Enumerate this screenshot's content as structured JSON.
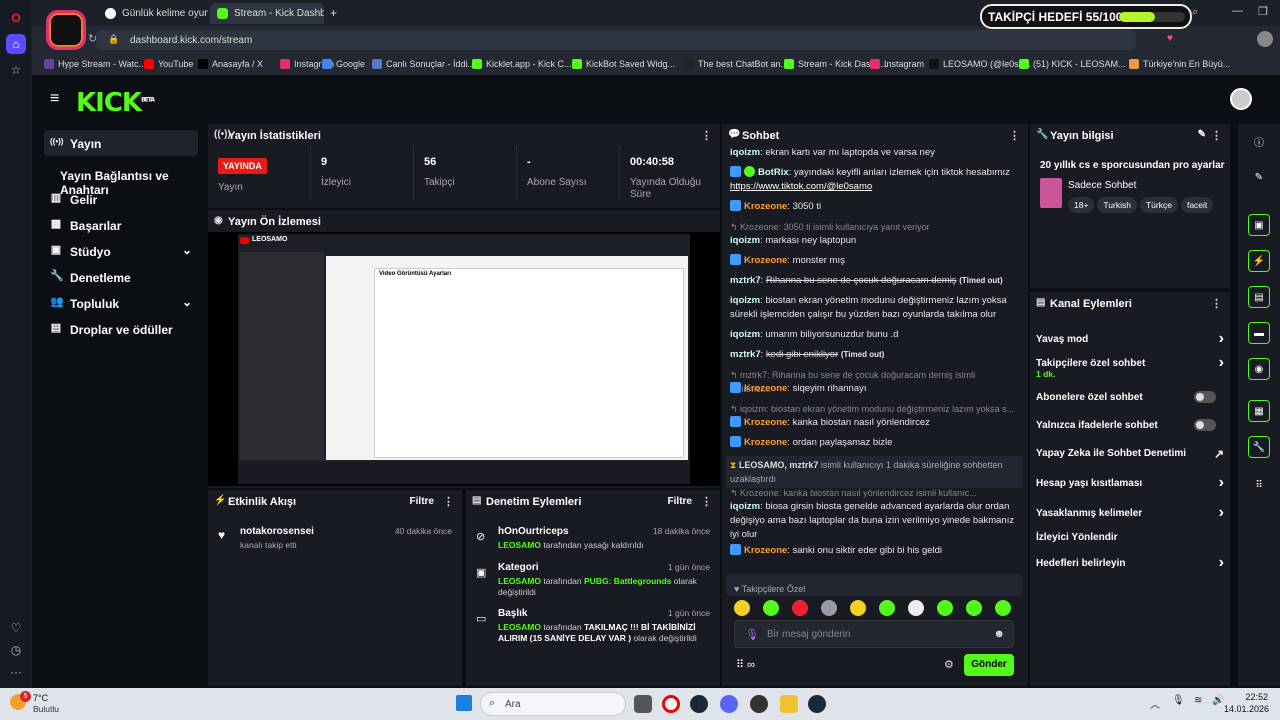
{
  "browser": {
    "tabs": [
      {
        "label": "Günlük kelime oyunu - pa"
      },
      {
        "label": "Stream - Kick Dashboard"
      }
    ],
    "new_tab": "+",
    "url": "dashboard.kick.com/stream",
    "bookmarks": [
      "Hype Stream - Watc...",
      "YouTube",
      "Anasayfa / X",
      "Instagram",
      "Google",
      "Canlı Sonuçlar - İddi...",
      "Kicklet.app - Kick C...",
      "KickBot Saved Widg...",
      "The best ChatBot an...",
      "Stream - Kick Dashb...",
      "Instagram",
      "LEOSAMO (@le0sa...",
      "(51) KICK - LEOSAM...",
      "Türkiye'nin En Büyü..."
    ]
  },
  "goal": {
    "text": "TAKİPÇİ HEDEFİ 55/100",
    "progress": 0.55
  },
  "kick": {
    "logo": "KICK",
    "logo_sup": "BETA",
    "nav": [
      {
        "label": "Yayın",
        "icon": "broadcast-icon"
      },
      {
        "label": "Yayın Bağlantısı ve Anahtarı"
      },
      {
        "label": "Gelir",
        "icon": "money-icon"
      },
      {
        "label": "Başarılar",
        "icon": "trophy-icon"
      },
      {
        "label": "Stüdyo",
        "icon": "studio-icon"
      },
      {
        "label": "Denetleme",
        "icon": "wrench-icon"
      },
      {
        "label": "Topluluk",
        "icon": "people-icon"
      },
      {
        "label": "Droplar ve ödüller",
        "icon": "gift-icon"
      }
    ],
    "stats": {
      "title": "Yayın İstatistikleri",
      "live_badge": "YAYINDA",
      "live_label": "Yayın",
      "items": [
        {
          "value": "9",
          "label": "İzleyici"
        },
        {
          "value": "56",
          "label": "Takipçi"
        },
        {
          "value": "-",
          "label": "Abone Sayısı"
        },
        {
          "value": "00:40:58",
          "label": "Yayında Olduğu Süre"
        }
      ]
    },
    "preview": {
      "title": "Yayın Ön İzlemesi",
      "channel": "LEOSAMO",
      "window_title": "Video Görüntüsü Ayarları"
    },
    "activity": {
      "title": "Etkinlik Akışı",
      "filter": "Filtre",
      "items": [
        {
          "user": "notakorosensei",
          "text": "kanalı takip etti",
          "time": "40 dakika önce"
        }
      ]
    },
    "moderation": {
      "title": "Denetim Eylemleri",
      "filter": "Filtre",
      "items": [
        {
          "title": "hOnOurtriceps",
          "by": "LEOSAMO",
          "rest": "tarafından yasağı kaldırıldı",
          "time": "18 dakika önce"
        },
        {
          "title": "Kategori",
          "by": "LEOSAMO",
          "mid": "tarafından",
          "hl": "PUBG: Battlegrounds",
          "rest": "olarak değiştirildi",
          "time": "1 gün önce"
        },
        {
          "title": "Başlık",
          "by": "LEOSAMO",
          "mid": "tarafından",
          "hl": "TAKILMAÇ !!! Bİ TAKİBİNİZİ ALIRIM (15 SANİYE DELAY VAR )",
          "rest": "olarak değiştirildi",
          "time": "1 gün önce"
        }
      ]
    },
    "chat": {
      "title": "Sohbet",
      "messages": [
        {
          "user": "iqoizm",
          "text": "ekran kartı var mı laptopda ve varsa ney"
        },
        {
          "user": "BotRix",
          "text": "yayındaki keyifli anları izlemek için tiktok hesabımız",
          "link": "https://www.tiktok.com/@le0samo"
        },
        {
          "user": "Krozeone",
          "text": "3050 ti"
        },
        {
          "reply": "Krozeone: 3050 ti isimli kullanıcıya yanıt veriyor"
        },
        {
          "user": "iqoizm",
          "text": "markası ney laptopun"
        },
        {
          "user": "Krozeone",
          "text": "monster mış"
        },
        {
          "user": "mztrk7",
          "text": "Rihanna bu sene de çocuk doğuracam demiş",
          "tag": "(Timed out)"
        },
        {
          "user": "iqoizm",
          "text": "biostan ekran yönetim modunu değiştirmeniz lazım yoksa sürekli işlemciden çalışır bu yüzden bazı oyunlarda takılma olur"
        },
        {
          "user": "iqoizm",
          "text": "umarım biliyorsunuzdur bunu .d"
        },
        {
          "user": "mztrk7",
          "text": "kedi gibi enikliyor",
          "tag": "(Timed out)"
        },
        {
          "reply": "mztrk7: Rihanna bu sene de çocuk doğuracam demiş isimli kullanıcı..."
        },
        {
          "user": "Krozeone",
          "text": "siqeyim rihannayı"
        },
        {
          "reply": "iqoizm: biostan ekran yönetim modunu değiştirmeniz lazım yoksa s..."
        },
        {
          "user": "Krozeone",
          "text": "kanka biostan nasıl yönlendircez"
        },
        {
          "user": "Krozeone",
          "text": "ordan paylaşamaz bizle"
        },
        {
          "system": "LEOSAMO, mztrk7",
          "system_text": "isimli kullanıcıyı 1 dakika süreliğine sohbetten uzaklaştırdı"
        },
        {
          "reply": "Krozeone: kanka biostan nasıl yönlendircez isimli kullanıc..."
        },
        {
          "user": "iqoizm",
          "text": "biosa girsin biosta genelde advanced ayarlarda olur ordan değişiyo ama bazı laptoplar da buna izin verilmiyo yinede bakmanız iyi olur"
        },
        {
          "user": "Krozeone",
          "text": "sanki onu siktir eder gibi bi his geldi"
        }
      ],
      "emote_section": "Takipçilere Özel",
      "placeholder": "Bir mesaj gönderin",
      "send": "Gönder"
    },
    "info": {
      "title": "Yayın bilgisi",
      "stream_title": "20 yıllık cs e sporcusundan pro ayarlar",
      "category": "Sadece Sohbet",
      "tags": [
        "18+",
        "Turkish",
        "Türkçe",
        "faceit"
      ]
    },
    "actions": {
      "title": "Kanal Eylemleri",
      "items": [
        {
          "label": "Yavaş mod"
        },
        {
          "label": "Takipçilere özel sohbet",
          "sub": "1 dk."
        },
        {
          "label": "Abonelere özel sohbet"
        },
        {
          "label": "Yalnızca ifadelerle sohbet"
        },
        {
          "label": "Yapay Zeka ile Sohbet Denetimi"
        },
        {
          "label": "Hesap yaşı kısıtlaması"
        },
        {
          "label": "Yasaklanmış kelimeler"
        },
        {
          "label": "İzleyici Yönlendir"
        },
        {
          "label": "Hedefleri belirleyin"
        }
      ]
    }
  },
  "taskbar": {
    "weather_temp": "7°C",
    "weather_text": "Bulutlu",
    "search": "Ara",
    "time": "22:52",
    "date": "14.01.2026",
    "notif": "5"
  }
}
